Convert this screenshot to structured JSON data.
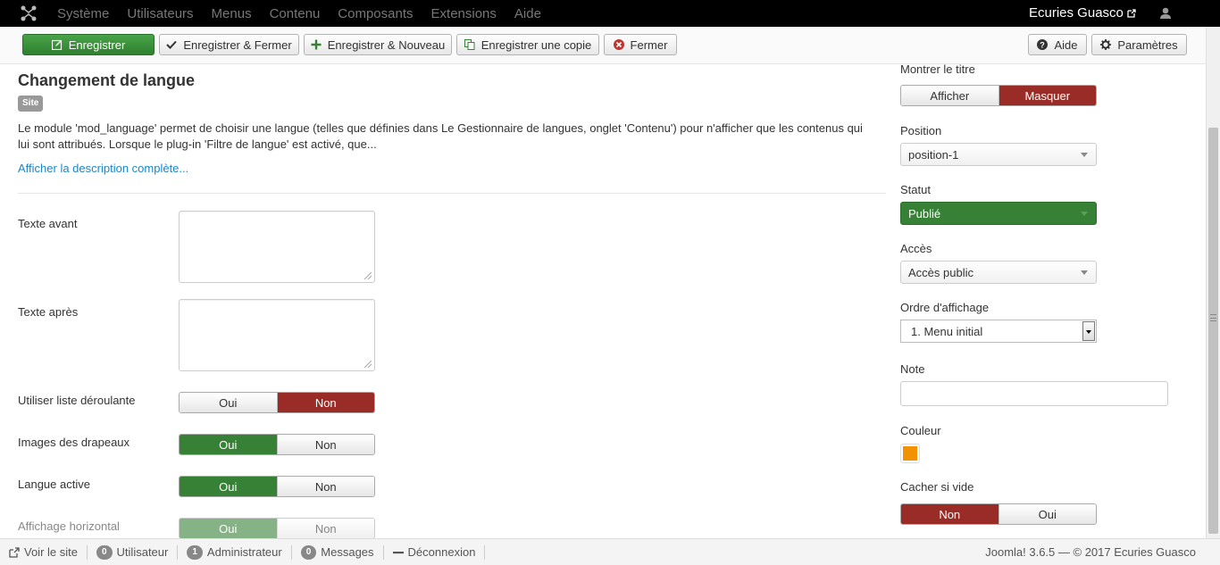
{
  "navbar": {
    "menu": [
      "Système",
      "Utilisateurs",
      "Menus",
      "Contenu",
      "Composants",
      "Extensions",
      "Aide"
    ],
    "site_name": "Ecuries Guasco"
  },
  "toolbar": {
    "save": "Enregistrer",
    "save_close": "Enregistrer & Fermer",
    "save_new": "Enregistrer & Nouveau",
    "save_copy": "Enregistrer une copie",
    "close": "Fermer",
    "help": "Aide",
    "options": "Paramètres"
  },
  "module": {
    "title": "Changement de langue",
    "badge": "Site",
    "description": "Le module 'mod_language' permet de choisir une langue (telles que définies dans Le Gestionnaire de langues, onglet 'Contenu') pour n'afficher que les contenus qui lui sont attribués. Lorsque le plug-in 'Filtre de langue' est activé, que...",
    "more_link": "Afficher la description complète..."
  },
  "fields": {
    "text_before": "Texte avant",
    "text_after": "Texte après",
    "dropdown": {
      "label": "Utiliser liste déroulante",
      "yes": "Oui",
      "no": "Non"
    },
    "flags": {
      "label": "Images des drapeaux",
      "yes": "Oui",
      "no": "Non"
    },
    "active": {
      "label": "Langue active",
      "yes": "Oui",
      "no": "Non"
    },
    "horizontal": {
      "label": "Affichage horizontal",
      "yes": "Oui",
      "no": "Non"
    }
  },
  "sidebar": {
    "show_title": {
      "label": "Montrer le titre",
      "show": "Afficher",
      "hide": "Masquer"
    },
    "position": {
      "label": "Position",
      "value": "position-1"
    },
    "status": {
      "label": "Statut",
      "value": "Publié"
    },
    "access": {
      "label": "Accès",
      "value": "Accès public"
    },
    "ordering": {
      "label": "Ordre d'affichage",
      "value": "1. Menu initial"
    },
    "note": {
      "label": "Note",
      "value": ""
    },
    "color": {
      "label": "Couleur",
      "value": "#f39200"
    },
    "hide_empty": {
      "label": "Cacher si vide",
      "no": "Non",
      "yes": "Oui"
    }
  },
  "statusbar": {
    "view_site": "Voir le site",
    "users_count": "0",
    "users_label": "Utilisateur",
    "admins_count": "1",
    "admins_label": "Administrateur",
    "messages_count": "0",
    "messages_label": "Messages",
    "logout": "Déconnexion",
    "copyright": "Joomla! 3.6.5  —  © 2017 Ecuries Guasco"
  },
  "colors": {
    "accent_green": "#378137",
    "accent_red": "#9a2c28",
    "link": "#1a87c9"
  }
}
